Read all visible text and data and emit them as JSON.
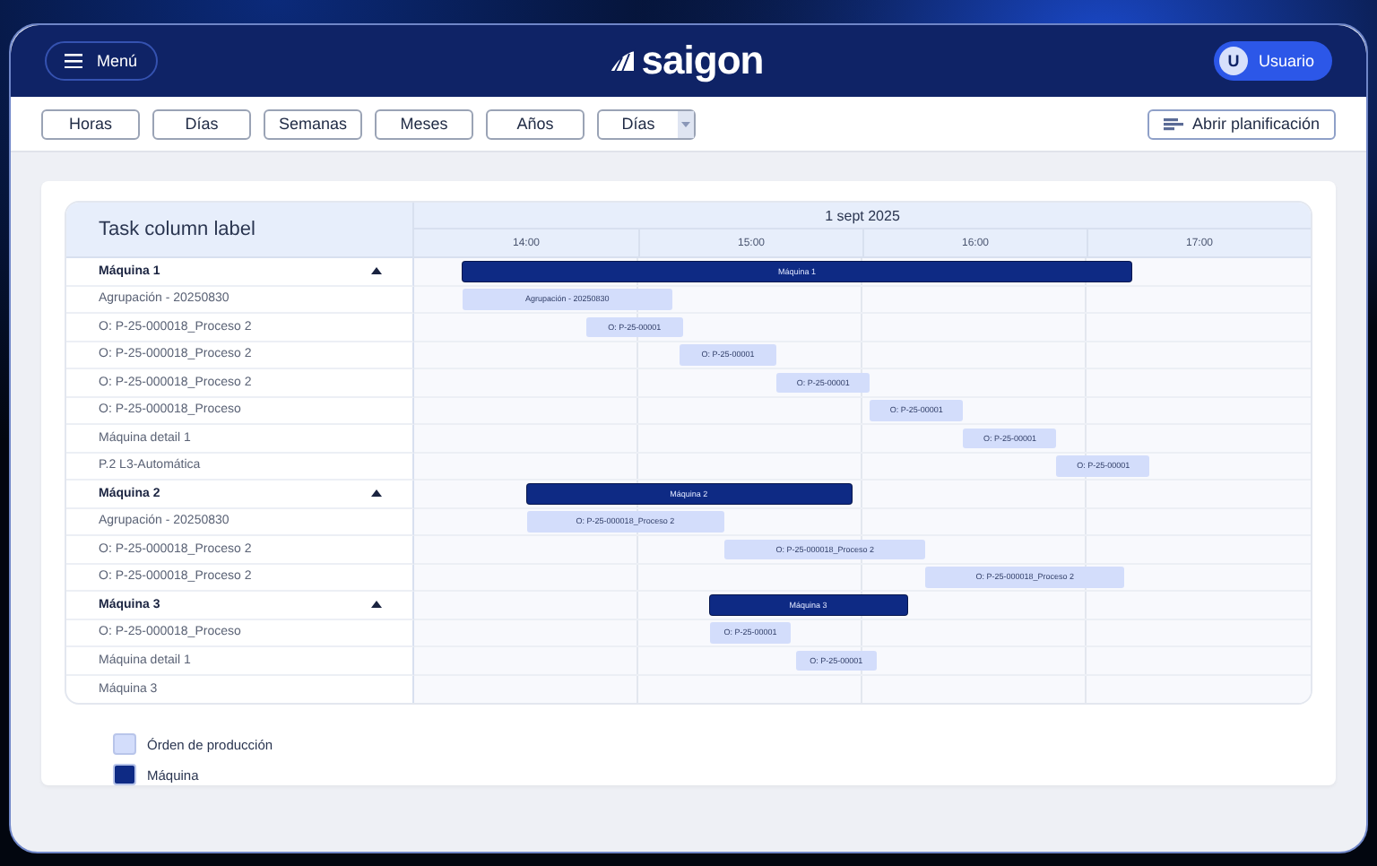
{
  "header": {
    "menu_label": "Menú",
    "logo": "saigon",
    "user": {
      "initial": "U",
      "name": "Usuario"
    }
  },
  "toolbar": {
    "scale_buttons": [
      "Horas",
      "Días",
      "Semanas",
      "Meses",
      "Años"
    ],
    "scale_select": {
      "value": "Días"
    },
    "plan_button": "Abrir planificación"
  },
  "gantt": {
    "task_column_label": "Task column label",
    "date": "1 sept 2025",
    "hours": [
      "14:00",
      "15:00",
      "16:00",
      "17:00"
    ],
    "rows": [
      {
        "label": "Máquina 1",
        "kind": "machine",
        "expanded": true,
        "bars": [
          {
            "label": "Máquina 1",
            "kind": "machine"
          }
        ]
      },
      {
        "label": "Agrupación - 20250830",
        "kind": "task",
        "bars": [
          {
            "label": "Agrupación - 20250830",
            "kind": "order"
          }
        ]
      },
      {
        "label": "O: P-25-000018_Proceso 2",
        "kind": "task",
        "bars": [
          {
            "label": "O: P-25-00001",
            "kind": "order"
          }
        ]
      },
      {
        "label": "O: P-25-000018_Proceso 2",
        "kind": "task",
        "bars": [
          {
            "label": "O: P-25-00001",
            "kind": "order"
          }
        ]
      },
      {
        "label": "O: P-25-000018_Proceso 2",
        "kind": "task",
        "bars": [
          {
            "label": "O: P-25-00001",
            "kind": "order"
          }
        ]
      },
      {
        "label": "O: P-25-000018_Proceso",
        "kind": "task",
        "bars": [
          {
            "label": "O: P-25-00001",
            "kind": "order"
          }
        ]
      },
      {
        "label": "Máquina detail 1",
        "kind": "task",
        "bars": [
          {
            "label": "O: P-25-00001",
            "kind": "order"
          }
        ]
      },
      {
        "label": "P.2 L3-Automática",
        "kind": "task",
        "bars": [
          {
            "label": "O: P-25-00001",
            "kind": "order"
          }
        ]
      },
      {
        "label": "Máquina 2",
        "kind": "machine",
        "expanded": true,
        "bars": [
          {
            "label": "Máquina 2",
            "kind": "machine"
          }
        ]
      },
      {
        "label": "Agrupación - 20250830",
        "kind": "task",
        "bars": [
          {
            "label": "O: P-25-000018_Proceso 2",
            "kind": "order"
          }
        ]
      },
      {
        "label": "O: P-25-000018_Proceso 2",
        "kind": "task",
        "bars": [
          {
            "label": "O: P-25-000018_Proceso 2",
            "kind": "order"
          }
        ]
      },
      {
        "label": "O: P-25-000018_Proceso 2",
        "kind": "task",
        "bars": [
          {
            "label": "O: P-25-000018_Proceso 2",
            "kind": "order"
          }
        ]
      },
      {
        "label": "Máquina 3",
        "kind": "machine",
        "expanded": true,
        "bars": [
          {
            "label": "Máquina 3",
            "kind": "machine"
          }
        ]
      },
      {
        "label": "O: P-25-000018_Proceso",
        "kind": "task",
        "bars": [
          {
            "label": "O: P-25-00001",
            "kind": "order"
          }
        ]
      },
      {
        "label": "Máquina detail 1",
        "kind": "task",
        "bars": [
          {
            "label": "O: P-25-00001",
            "kind": "order"
          }
        ]
      },
      {
        "label": "Máquina 3",
        "kind": "task"
      }
    ]
  },
  "legend": [
    {
      "label": "Órden de producción",
      "color": "#d3ddfb"
    },
    {
      "label": "Máquina",
      "color": "#0e2a84"
    }
  ]
}
